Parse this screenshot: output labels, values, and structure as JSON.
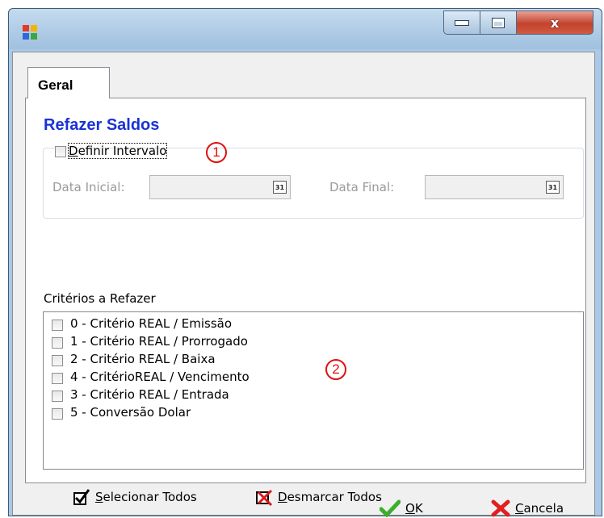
{
  "window": {
    "title": "",
    "controls": {
      "minimize_icon": "minimize-icon",
      "maximize_icon": "maximize-icon",
      "close_glyph": "x"
    }
  },
  "tabs": [
    {
      "label": "Geral",
      "selected": true
    }
  ],
  "section_title": "Refazer Saldos",
  "interval": {
    "checkbox_label": "Definir Intervalo",
    "checked": false,
    "start_label": "Data Inicial:",
    "start_value": "",
    "end_label": "Data Final:",
    "end_value": "",
    "calendar_glyph": "31"
  },
  "criteria": {
    "label": "Critérios a Refazer",
    "items": [
      {
        "label": "0 - Critério REAL / Emissão",
        "checked": false
      },
      {
        "label": "1 - Critério REAL / Prorrogado",
        "checked": false
      },
      {
        "label": "2 - Critério REAL / Baixa",
        "checked": false
      },
      {
        "label": "4 - CritérioREAL / Vencimento",
        "checked": false
      },
      {
        "label": "3 - Critério REAL / Entrada",
        "checked": false
      },
      {
        "label": "5 - Conversão Dolar",
        "checked": false
      }
    ]
  },
  "markers": [
    "1",
    "2"
  ],
  "actions": {
    "select_all": "Selecionar Todos",
    "deselect_all": "Desmarcar Todos"
  },
  "buttons": {
    "ok": "OK",
    "cancel": "Cancela"
  },
  "colors": {
    "heading": "#1a33d6",
    "marker": "#e01010",
    "titlebar": "#a9c9e6"
  }
}
